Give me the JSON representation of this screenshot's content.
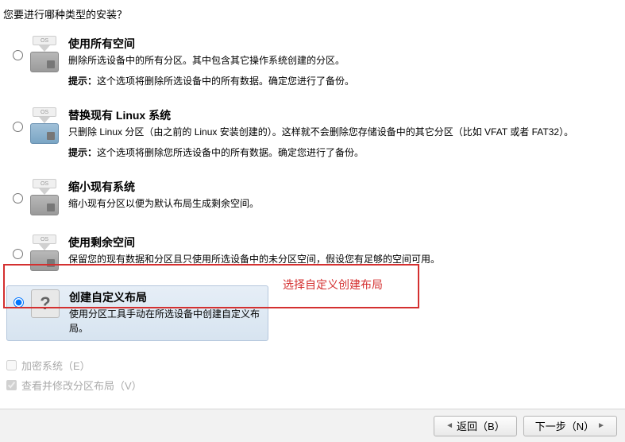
{
  "header": {
    "question": "您要进行哪种类型的安装？"
  },
  "options": [
    {
      "title": "使用所有空间",
      "desc": "删除所选设备中的所有分区。其中包含其它操作系统创建的分区。",
      "hint_label": "提示：",
      "hint": "这个选项将删除所选设备中的所有数据。确定您进行了备份。",
      "icon_label": "OS"
    },
    {
      "title": "替换现有 Linux 系统",
      "desc": "只删除 Linux 分区（由之前的 Linux 安装创建的）。这样就不会删除您存储设备中的其它分区（比如 VFAT 或者 FAT32）。",
      "hint_label": "提示：",
      "hint": "这个选项将删除您所选设备中的所有数据。确定您进行了备份。",
      "icon_label": "OS"
    },
    {
      "title": "缩小现有系统",
      "desc": "缩小现有分区以便为默认布局生成剩余空间。",
      "icon_label": "OS"
    },
    {
      "title": "使用剩余空间",
      "desc": "保留您的现有数据和分区且只使用所选设备中的未分区空间，假设您有足够的空间可用。",
      "icon_label": "OS"
    },
    {
      "title": "创建自定义布局",
      "desc": "使用分区工具手动在所选设备中创建自定义布局。",
      "icon_label": "?"
    }
  ],
  "annotation": {
    "text": "选择自定义创建布局"
  },
  "checkboxes": {
    "encrypt": "加密系统（E）",
    "review": "查看并修改分区布局（V）"
  },
  "buttons": {
    "back": "返回（B）",
    "next": "下一步（N）"
  }
}
